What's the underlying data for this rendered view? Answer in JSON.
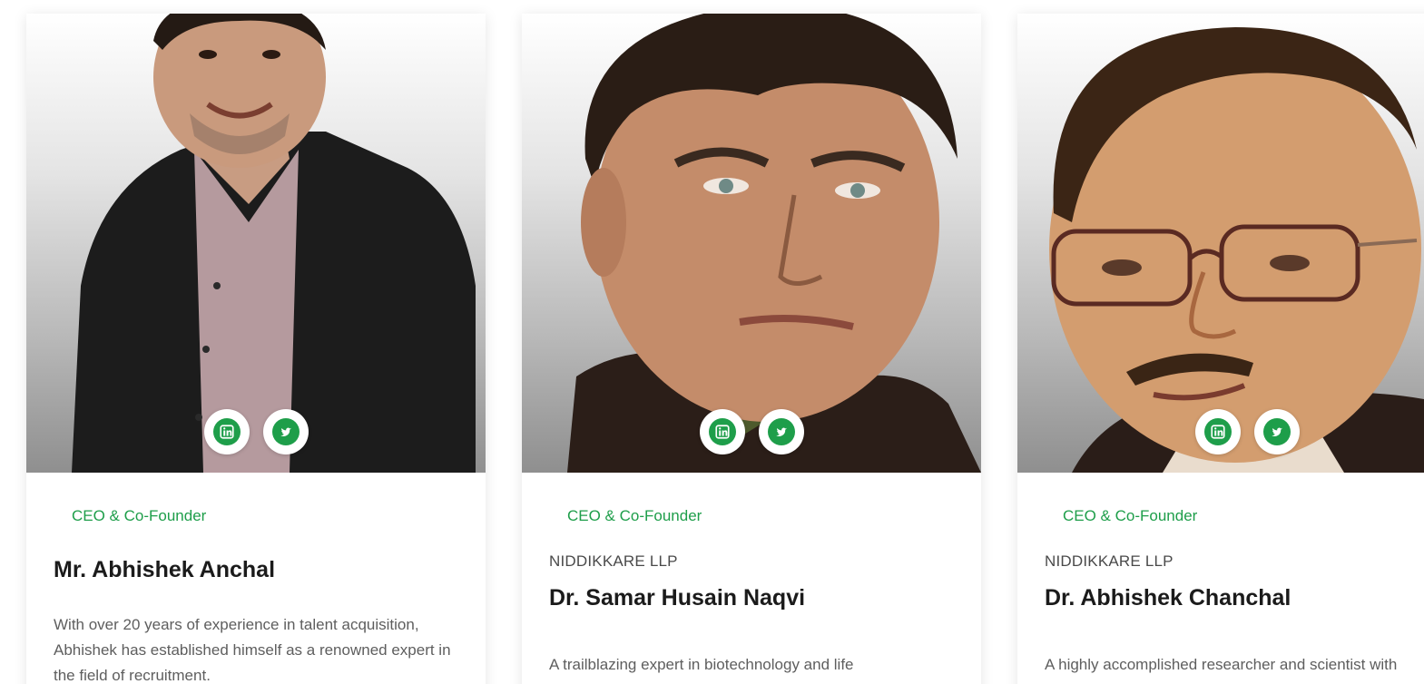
{
  "team": [
    {
      "role": "CEO & Co-Founder",
      "company": "",
      "name": "Mr. Abhishek Anchal",
      "bio": "With over 20 years of experience in talent acquisition, Abhishek has established himself as a renowned expert in the field of recruitment.",
      "socials": [
        "linkedin-icon",
        "twitter-icon"
      ]
    },
    {
      "role": "CEO & Co-Founder",
      "company": "NIDDIKKARE LLP",
      "name": "Dr. Samar Husain Naqvi",
      "bio": "A trailblazing expert in biotechnology and life",
      "socials": [
        "linkedin-icon",
        "twitter-icon"
      ]
    },
    {
      "role": "CEO & Co-Founder",
      "company": "NIDDIKKARE LLP",
      "name": "Dr. Abhishek Chanchal",
      "bio": "A highly accomplished researcher and scientist with",
      "socials": [
        "linkedin-icon",
        "twitter-icon"
      ]
    }
  ],
  "colors": {
    "accent": "#1e9e4a",
    "name_text": "#1b1b1b",
    "bio_text": "#5e5e5e"
  }
}
